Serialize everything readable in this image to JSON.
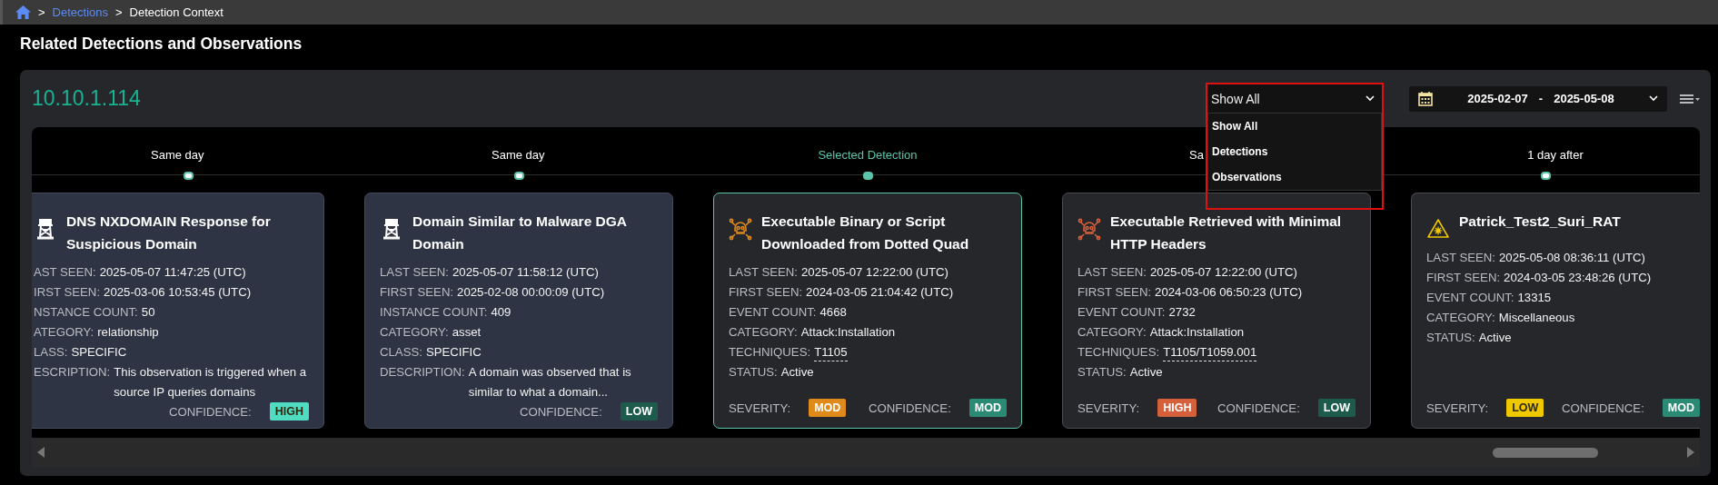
{
  "breadcrumb": [
    {
      "kind": "home"
    },
    {
      "kind": "separator",
      "text": ">"
    },
    {
      "kind": "link",
      "text": "Detections"
    },
    {
      "kind": "separator",
      "text": ">"
    },
    {
      "kind": "current",
      "text": "Detection Context"
    }
  ],
  "section_title": "Related Detections and Observations",
  "host": "10.10.1.114",
  "filter": {
    "value": "Show All",
    "expanded": true,
    "highlighted": true,
    "options": [
      "Show All",
      "Detections",
      "Observations"
    ]
  },
  "date_range": {
    "start": "2025-02-07",
    "separator": "-",
    "end": "2025-05-08"
  },
  "timeline": [
    {
      "label": "Same day",
      "selected": false,
      "card": {
        "kind": "observation",
        "title": "DNS NXDOMAIN Response for Suspicious Domain",
        "fields": [
          {
            "label": "AST SEEN:",
            "value": "2025-05-07 11:47:25 (UTC)",
            "kind": "text"
          },
          {
            "label": "IRST SEEN:",
            "value": "2025-03-06 10:53:45 (UTC)",
            "kind": "text"
          },
          {
            "label": "NSTANCE COUNT:",
            "value": "50",
            "kind": "text"
          },
          {
            "label": "ATEGORY:",
            "value": "relationship",
            "kind": "text"
          },
          {
            "label": "LASS:",
            "value": "SPECIFIC",
            "kind": "text"
          },
          {
            "label": "ESCRIPTION:",
            "value": "This observation is triggered when a source IP queries domains",
            "kind": "text"
          }
        ],
        "confidence": {
          "label": "CONFIDENCE:",
          "value": "HIGH",
          "color": "#4fdcc0"
        }
      }
    },
    {
      "label": "Same day",
      "selected": false,
      "card": {
        "kind": "observation",
        "title": "Domain Similar to Malware DGA Domain",
        "fields": [
          {
            "label": "LAST SEEN:",
            "value": "2025-05-07 11:58:12 (UTC)",
            "kind": "text"
          },
          {
            "label": "FIRST SEEN:",
            "value": "2025-02-08 00:00:09 (UTC)",
            "kind": "text"
          },
          {
            "label": "INSTANCE COUNT:",
            "value": "409",
            "kind": "text"
          },
          {
            "label": "CATEGORY:",
            "value": "asset",
            "kind": "text"
          },
          {
            "label": "CLASS:",
            "value": "SPECIFIC",
            "kind": "text"
          },
          {
            "label": "DESCRIPTION:",
            "value": "A domain was observed that is similar to what a domain...",
            "kind": "text"
          }
        ],
        "confidence": {
          "label": "CONFIDENCE:",
          "value": "LOW",
          "color": "#1d5c4c"
        }
      }
    },
    {
      "label": "Selected Detection",
      "selected": true,
      "card": {
        "kind": "detection",
        "title": "Executable Binary or Script Downloaded from Dotted Quad",
        "fields": [
          {
            "label": "LAST SEEN:",
            "value": "2025-05-07 12:22:00 (UTC)",
            "kind": "text"
          },
          {
            "label": "FIRST SEEN:",
            "value": "2024-03-05 21:04:42 (UTC)",
            "kind": "text"
          },
          {
            "label": "EVENT COUNT:",
            "value": "4668",
            "kind": "text"
          },
          {
            "label": "CATEGORY:",
            "value": "Attack:Installation",
            "kind": "text"
          },
          {
            "label": "TECHNIQUES:",
            "value": "T1105",
            "kind": "link"
          },
          {
            "label": "STATUS:",
            "value": "Active",
            "kind": "text"
          }
        ],
        "severity": {
          "label": "SEVERITY:",
          "value": "MOD",
          "color": "#e08a1c"
        },
        "confidence": {
          "label": "CONFIDENCE:",
          "value": "MOD",
          "color": "#2b8a74"
        }
      }
    },
    {
      "label": "Sa",
      "selected": false,
      "card": {
        "kind": "detection",
        "title": "Executable Retrieved with Minimal HTTP Headers",
        "fields": [
          {
            "label": "LAST SEEN:",
            "value": "2025-05-07 12:22:00 (UTC)",
            "kind": "text"
          },
          {
            "label": "FIRST SEEN:",
            "value": "2024-03-06 06:50:23 (UTC)",
            "kind": "text"
          },
          {
            "label": "EVENT COUNT:",
            "value": "2732",
            "kind": "text"
          },
          {
            "label": "CATEGORY:",
            "value": "Attack:Installation",
            "kind": "text"
          },
          {
            "label": "TECHNIQUES:",
            "value": "T1105/T1059.001",
            "kind": "link"
          },
          {
            "label": "STATUS:",
            "value": "Active",
            "kind": "text"
          }
        ],
        "severity": {
          "label": "SEVERITY:",
          "value": "HIGH",
          "color": "#d6603c"
        },
        "confidence": {
          "label": "CONFIDENCE:",
          "value": "LOW",
          "color": "#1d5c4c"
        }
      }
    },
    {
      "label": "1 day after",
      "selected": false,
      "card": {
        "kind": "alert",
        "title": "Patrick_Test2_Suri_RAT",
        "fields": [
          {
            "label": "LAST SEEN:",
            "value": "2025-05-08 08:36:11 (UTC)",
            "kind": "text"
          },
          {
            "label": "FIRST SEEN:",
            "value": "2024-03-05 23:48:26 (UTC)",
            "kind": "text"
          },
          {
            "label": "EVENT COUNT:",
            "value": "13315",
            "kind": "text"
          },
          {
            "label": "CATEGORY:",
            "value": "Miscellaneous",
            "kind": "text"
          },
          {
            "label": "STATUS:",
            "value": "Active",
            "kind": "text"
          }
        ],
        "severity": {
          "label": "SEVERITY:",
          "value": "LOW",
          "color": "#f0c800"
        },
        "confidence": {
          "label": "CONFIDENCE:",
          "value": "MOD",
          "color": "#2b8a74"
        }
      }
    }
  ]
}
